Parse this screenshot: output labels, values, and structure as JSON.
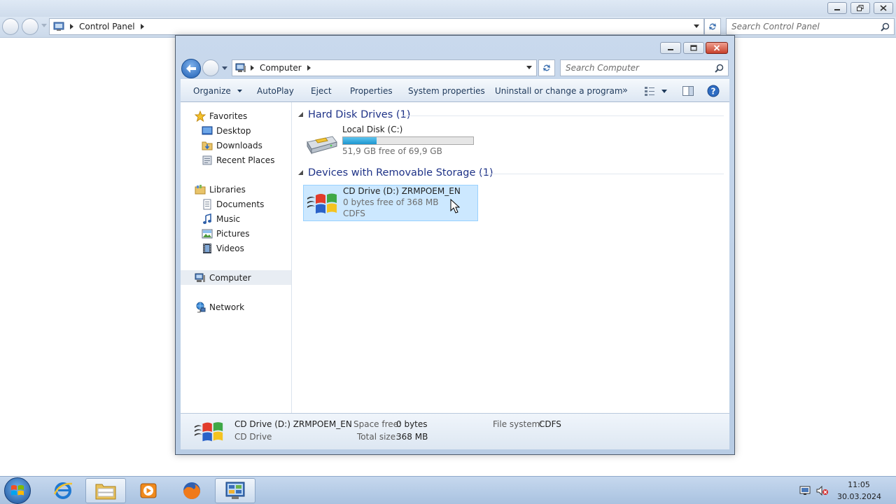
{
  "background_window": {
    "breadcrumb": [
      "Control Panel"
    ],
    "search_placeholder": "Search Control Panel"
  },
  "explorer": {
    "breadcrumb": [
      "Computer"
    ],
    "search_placeholder": "Search Computer",
    "toolbar": {
      "organize": "Organize",
      "autoplay": "AutoPlay",
      "eject": "Eject",
      "properties": "Properties",
      "system_properties": "System properties",
      "uninstall": "Uninstall or change a program",
      "more": "»"
    },
    "nav": {
      "favorites": "Favorites",
      "desktop": "Desktop",
      "downloads": "Downloads",
      "recent_places": "Recent Places",
      "libraries": "Libraries",
      "documents": "Documents",
      "music": "Music",
      "pictures": "Pictures",
      "videos": "Videos",
      "computer": "Computer",
      "network": "Network"
    },
    "groups": {
      "hdd_header": "Hard Disk Drives (1)",
      "removable_header": "Devices with Removable Storage (1)"
    },
    "drives": {
      "c": {
        "name": "Local Disk (C:)",
        "free_text": "51,9 GB free of 69,9 GB",
        "used_fraction": 0.257
      },
      "d": {
        "name": "CD Drive (D:) ZRMPOEM_EN",
        "free_text": "0 bytes free of 368 MB",
        "filesystem": "CDFS"
      }
    },
    "details": {
      "name": "CD Drive (D:) ZRMPOEM_EN",
      "type": "CD Drive",
      "space_free_label": "Space free:",
      "space_free_value": "0 bytes",
      "total_size_label": "Total size:",
      "total_size_value": "368 MB",
      "file_system_label": "File system:",
      "file_system_value": "CDFS"
    }
  },
  "taskbar": {
    "time": "11:05",
    "date": "30.03.2024"
  },
  "colors": {
    "accent_blue": "#1e3287",
    "selection_bg": "#cce8ff",
    "selection_border": "#99d1ff",
    "disk_bar_fill": "#26a0da"
  }
}
